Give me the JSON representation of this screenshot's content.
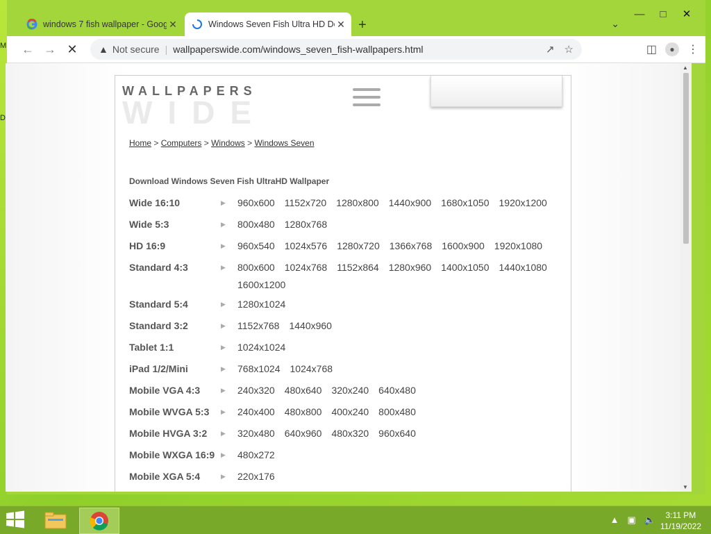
{
  "desktop": {
    "left_letters": [
      "M",
      "D"
    ]
  },
  "browser": {
    "tabs": [
      {
        "title": "windows 7 fish wallpaper - Goog",
        "active": false
      },
      {
        "title": "Windows Seven Fish Ultra HD De",
        "active": true
      }
    ],
    "new_tab_symbol": "+",
    "address": {
      "security_label": "Not secure",
      "url": "wallpaperswide.com/windows_seven_fish-wallpapers.html"
    }
  },
  "page": {
    "logo": {
      "line1": "WALLPAPERS",
      "line2": "WIDE"
    },
    "breadcrumb": [
      "Home",
      "Computers",
      "Windows",
      "Windows Seven"
    ],
    "download_title": "Download Windows Seven Fish UltraHD Wallpaper",
    "resolution_groups": [
      {
        "label": "Wide 16:10",
        "resolutions": [
          "960x600",
          "1152x720",
          "1280x800",
          "1440x900",
          "1680x1050",
          "1920x1200"
        ]
      },
      {
        "label": "Wide 5:3",
        "resolutions": [
          "800x480",
          "1280x768"
        ]
      },
      {
        "label": "HD 16:9",
        "resolutions": [
          "960x540",
          "1024x576",
          "1280x720",
          "1366x768",
          "1600x900",
          "1920x1080"
        ]
      },
      {
        "label": "Standard 4:3",
        "resolutions": [
          "800x600",
          "1024x768",
          "1152x864",
          "1280x960",
          "1400x1050",
          "1440x1080",
          "1600x1200"
        ]
      },
      {
        "label": "Standard 5:4",
        "resolutions": [
          "1280x1024"
        ]
      },
      {
        "label": "Standard 3:2",
        "resolutions": [
          "1152x768",
          "1440x960"
        ]
      },
      {
        "label": "Tablet 1:1",
        "resolutions": [
          "1024x1024"
        ]
      },
      {
        "label": "iPad 1/2/Mini",
        "resolutions": [
          "768x1024",
          "1024x768"
        ]
      },
      {
        "label": "Mobile VGA 4:3",
        "resolutions": [
          "240x320",
          "480x640",
          "320x240",
          "640x480"
        ]
      },
      {
        "label": "Mobile WVGA 5:3",
        "resolutions": [
          "240x400",
          "480x800",
          "400x240",
          "800x480"
        ]
      },
      {
        "label": "Mobile HVGA 3:2",
        "resolutions": [
          "320x480",
          "640x960",
          "480x320",
          "960x640"
        ]
      },
      {
        "label": "Mobile WXGA 16:9",
        "resolutions": [
          "480x272"
        ]
      },
      {
        "label": "Mobile XGA 5:4",
        "resolutions": [
          "220x176"
        ]
      }
    ]
  },
  "taskbar": {
    "clock_time": "3:11 PM",
    "clock_date": "11/19/2022"
  },
  "colors": {
    "desktop_green": "#a7dc33",
    "taskbar": "#79a928"
  }
}
